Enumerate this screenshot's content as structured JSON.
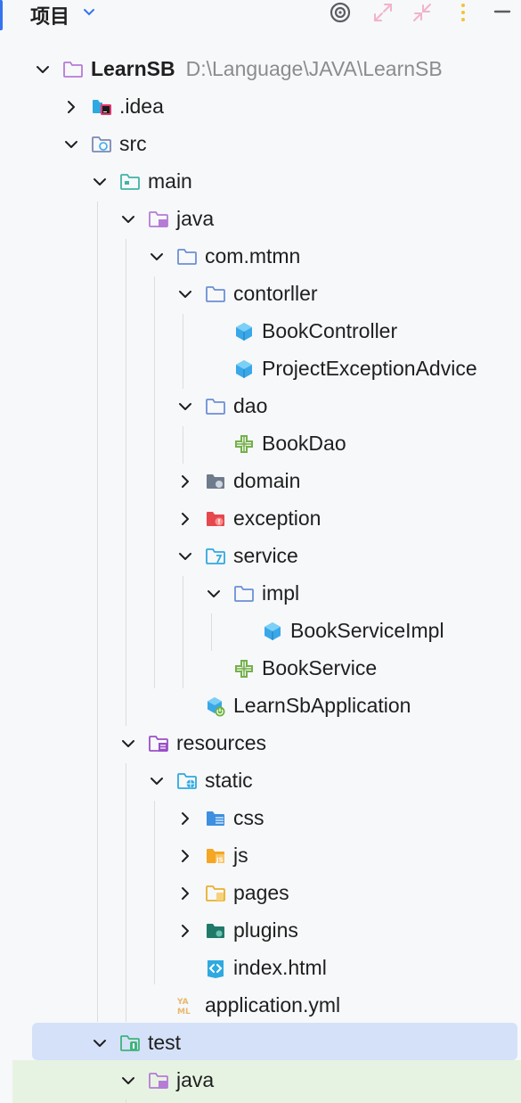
{
  "header": {
    "title": "项目",
    "buttons": [
      "locate-icon",
      "expand-all-icon",
      "collapse-all-icon",
      "more-icon",
      "minimize-icon"
    ]
  },
  "tree": [
    {
      "label": "LearnSB",
      "path": "D:\\Language\\JAVA\\LearnSB",
      "depth": 0,
      "arrow": "down",
      "icon": "module-folder-icon"
    },
    {
      "label": ".idea",
      "depth": 1,
      "arrow": "right",
      "icon": "idea-folder-icon"
    },
    {
      "label": "src",
      "depth": 1,
      "arrow": "down",
      "icon": "source-folder-icon"
    },
    {
      "label": "main",
      "depth": 2,
      "arrow": "down",
      "icon": "main-folder-icon"
    },
    {
      "label": "java",
      "depth": 3,
      "arrow": "down",
      "icon": "java-sources-folder-icon"
    },
    {
      "label": "com.mtmn",
      "depth": 4,
      "arrow": "down",
      "icon": "package-icon"
    },
    {
      "label": "contorller",
      "depth": 5,
      "arrow": "down",
      "icon": "package-icon"
    },
    {
      "label": "BookController",
      "depth": 6,
      "arrow": "none",
      "icon": "class-icon"
    },
    {
      "label": "ProjectExceptionAdvice",
      "depth": 6,
      "arrow": "none",
      "icon": "class-icon"
    },
    {
      "label": "dao",
      "depth": 5,
      "arrow": "down",
      "icon": "package-icon"
    },
    {
      "label": "BookDao",
      "depth": 6,
      "arrow": "none",
      "icon": "interface-icon"
    },
    {
      "label": "domain",
      "depth": 5,
      "arrow": "right",
      "icon": "domain-folder-icon"
    },
    {
      "label": "exception",
      "depth": 5,
      "arrow": "right",
      "icon": "exception-folder-icon"
    },
    {
      "label": "service",
      "depth": 5,
      "arrow": "down",
      "icon": "service-folder-icon"
    },
    {
      "label": "impl",
      "depth": 6,
      "arrow": "down",
      "icon": "package-icon"
    },
    {
      "label": "BookServiceImpl",
      "depth": 7,
      "arrow": "none",
      "icon": "class-icon"
    },
    {
      "label": "BookService",
      "depth": 6,
      "arrow": "none",
      "icon": "interface-icon"
    },
    {
      "label": "LearnSbApplication",
      "depth": 5,
      "arrow": "none",
      "icon": "spring-boot-app-icon"
    },
    {
      "label": "resources",
      "depth": 3,
      "arrow": "down",
      "icon": "resources-folder-icon"
    },
    {
      "label": "static",
      "depth": 4,
      "arrow": "down",
      "icon": "static-folder-icon"
    },
    {
      "label": "css",
      "depth": 5,
      "arrow": "right",
      "icon": "css-folder-icon"
    },
    {
      "label": "js",
      "depth": 5,
      "arrow": "right",
      "icon": "js-folder-icon"
    },
    {
      "label": "pages",
      "depth": 5,
      "arrow": "right",
      "icon": "pages-folder-icon"
    },
    {
      "label": "plugins",
      "depth": 5,
      "arrow": "right",
      "icon": "plugins-folder-icon"
    },
    {
      "label": "index.html",
      "depth": 5,
      "arrow": "none",
      "icon": "html-file-icon"
    },
    {
      "label": "application.yml",
      "depth": 4,
      "arrow": "none",
      "icon": "yaml-file-icon"
    },
    {
      "label": "test",
      "depth": 2,
      "arrow": "down",
      "icon": "test-folder-icon",
      "selected": true
    },
    {
      "label": "java",
      "depth": 3,
      "arrow": "down",
      "icon": "java-test-folder-icon"
    }
  ],
  "colors": {
    "selection": "#d5e1f9",
    "test_highlight": "#e7f3e2",
    "folder_purple": "#b57bd6",
    "package_blue": "#6b8fd6",
    "class_blue": "#3aa7e8",
    "interface_green": "#74b04b"
  }
}
